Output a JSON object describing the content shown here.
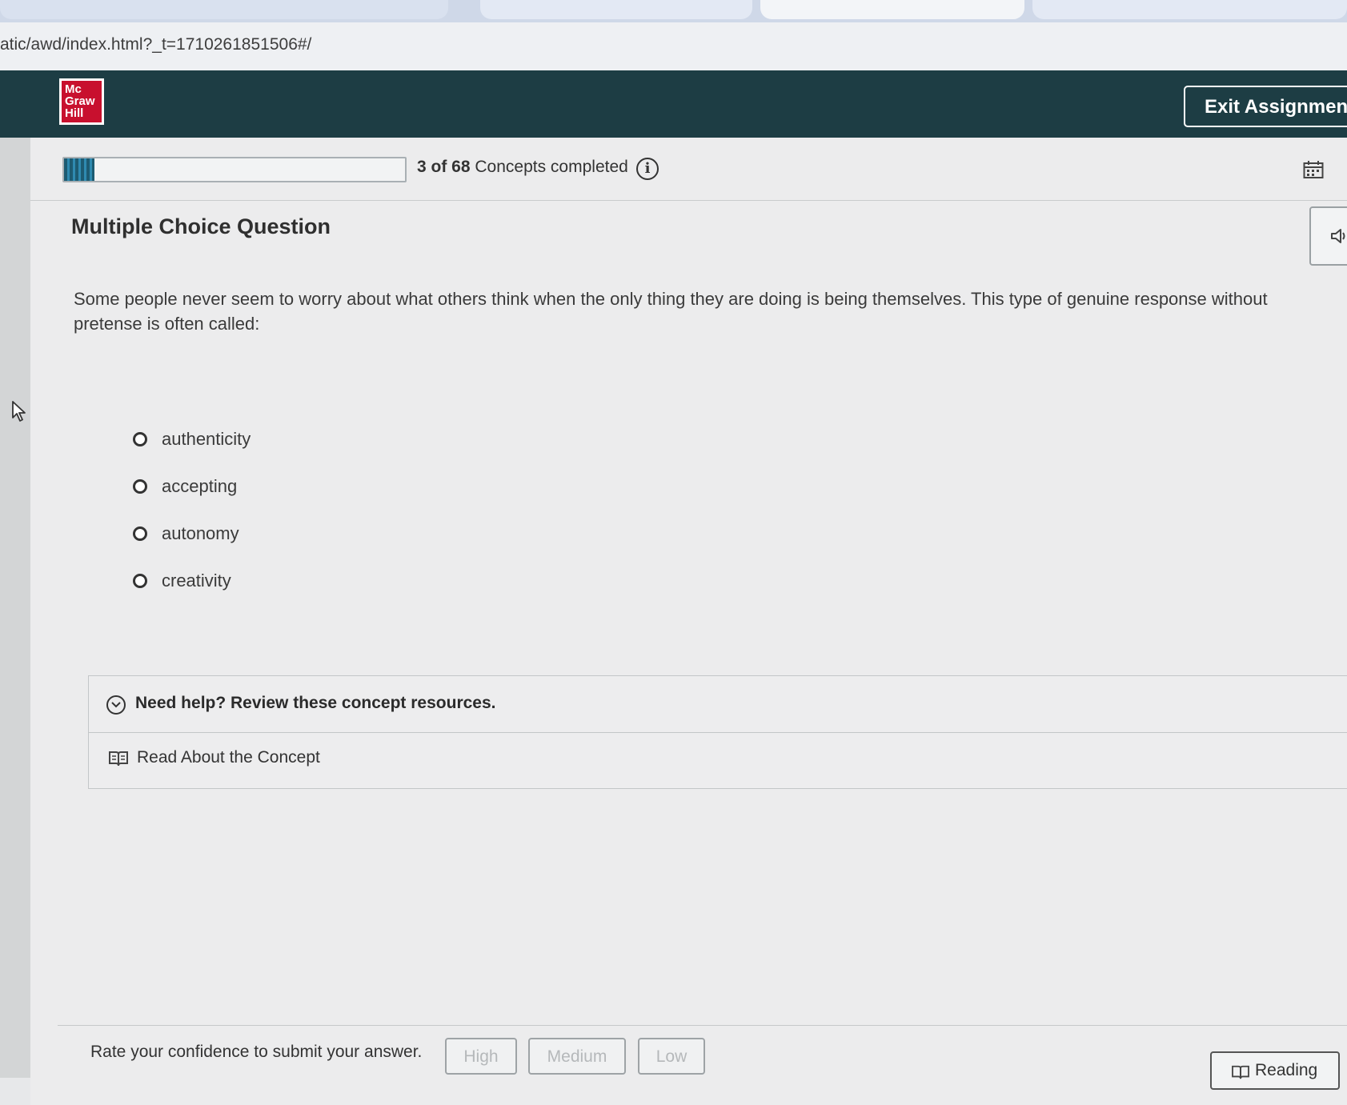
{
  "browser": {
    "url": "atic/awd/index.html?_t=1710261851506#/"
  },
  "header": {
    "logo_lines": [
      "Mc",
      "Graw",
      "Hill"
    ],
    "exit_label": "Exit Assignment",
    "brand_color": "#c8102e",
    "bar_color": "#1d3d44"
  },
  "progress": {
    "completed": "3 of 68",
    "label": "Concepts completed",
    "fraction": 0.09
  },
  "question": {
    "type_title": "Multiple Choice Question",
    "text": "Some people never seem to worry about what others think when the only thing they are doing is being themselves. This type of genuine response without pretense is often called:",
    "options": [
      {
        "label": "authenticity",
        "selected": false
      },
      {
        "label": "accepting",
        "selected": false
      },
      {
        "label": "autonomy",
        "selected": false
      },
      {
        "label": "creativity",
        "selected": false
      }
    ]
  },
  "help": {
    "title": "Need help? Review these concept resources.",
    "resource_label": "Read About the Concept"
  },
  "footer": {
    "confidence_prompt": "Rate your confidence to submit your answer.",
    "buttons": {
      "high": "High",
      "medium": "Medium",
      "low": "Low"
    },
    "reading_label": "Reading"
  },
  "icons": {
    "info": "info-icon",
    "calendar": "calendar-icon",
    "audio": "speaker-icon",
    "help_toggle": "chevron-down-circle-icon",
    "resource": "book-icon",
    "reading": "book-icon"
  }
}
